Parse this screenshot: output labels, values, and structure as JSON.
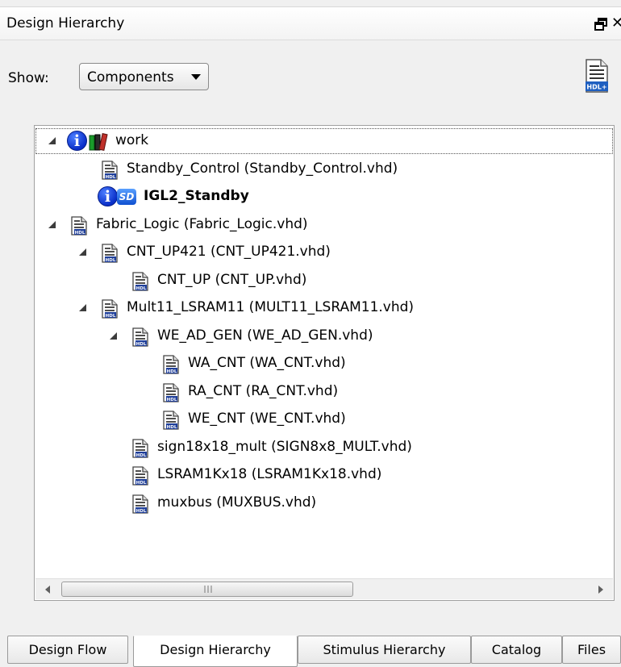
{
  "window": {
    "title": "Design Hierarchy"
  },
  "toolbar": {
    "show_label": "Show:",
    "show_value": "Components",
    "export_icon": "hdl-plus-icon"
  },
  "tree": {
    "rows": [
      {
        "label": "work",
        "bold": false,
        "icon": "library-icon",
        "info": true,
        "expanded": true
      },
      {
        "label": "Standby_Control (Standby_Control.vhd)",
        "bold": false,
        "icon": "hdl-file-icon"
      },
      {
        "label": "IGL2_Standby",
        "bold": true,
        "icon": "smartdesign-icon",
        "info": true
      },
      {
        "label": "Fabric_Logic (Fabric_Logic.vhd)",
        "bold": false,
        "icon": "hdl-file-icon",
        "expanded": true
      },
      {
        "label": "CNT_UP421 (CNT_UP421.vhd)",
        "bold": false,
        "icon": "hdl-file-icon",
        "expanded": true
      },
      {
        "label": "CNT_UP (CNT_UP.vhd)",
        "bold": false,
        "icon": "hdl-file-icon"
      },
      {
        "label": "Mult11_LSRAM11 (MULT11_LSRAM11.vhd)",
        "bold": false,
        "icon": "hdl-file-icon",
        "expanded": true
      },
      {
        "label": "WE_AD_GEN (WE_AD_GEN.vhd)",
        "bold": false,
        "icon": "hdl-file-icon",
        "expanded": true
      },
      {
        "label": "WA_CNT (WA_CNT.vhd)",
        "bold": false,
        "icon": "hdl-file-icon"
      },
      {
        "label": "RA_CNT (RA_CNT.vhd)",
        "bold": false,
        "icon": "hdl-file-icon"
      },
      {
        "label": "WE_CNT (WE_CNT.vhd)",
        "bold": false,
        "icon": "hdl-file-icon"
      },
      {
        "label": "sign18x18_mult (SIGN8x8_MULT.vhd)",
        "bold": false,
        "icon": "hdl-file-icon"
      },
      {
        "label": "LSRAM1Kx18 (LSRAM1Kx18.vhd)",
        "bold": false,
        "icon": "hdl-file-icon"
      },
      {
        "label": "muxbus (MUXBUS.vhd)",
        "bold": false,
        "icon": "hdl-file-icon"
      }
    ]
  },
  "tabs": [
    {
      "label": "Design Flow",
      "active": false
    },
    {
      "label": "Design Hierarchy",
      "active": true
    },
    {
      "label": "Stimulus Hierarchy",
      "active": false
    },
    {
      "label": "Catalog",
      "active": false
    },
    {
      "label": "Files",
      "active": false
    }
  ],
  "colors": {
    "info_blue": "#0a2fc8",
    "hdl_blue": "#1f3f9a"
  }
}
